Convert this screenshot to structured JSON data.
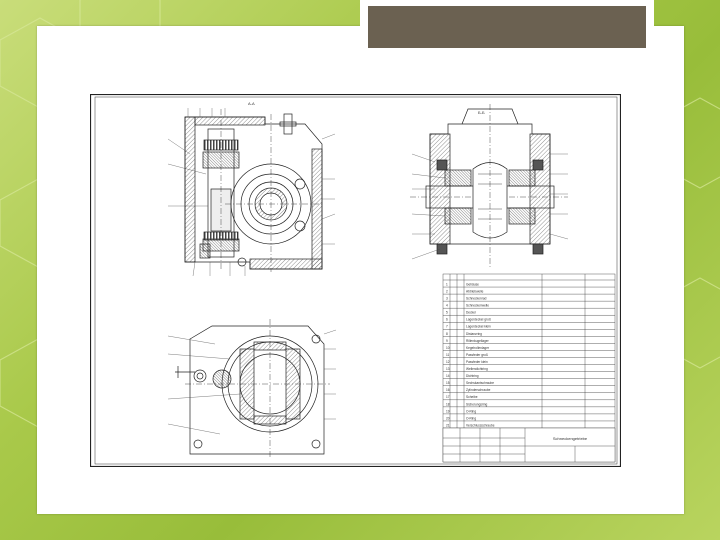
{
  "slide": {
    "title": "",
    "accent_colors": {
      "background": "#a9c94a",
      "title_bar": "#6b6151",
      "paper": "#ffffff"
    }
  },
  "drawing": {
    "view_aa_label": "A-A",
    "view_bb_label": "Б-Б",
    "part_list": {
      "rows": [
        {
          "pos": "1",
          "name": "Gehäuse"
        },
        {
          "pos": "2",
          "name": "Abtriebwelle"
        },
        {
          "pos": "3",
          "name": "Schneckenrad"
        },
        {
          "pos": "4",
          "name": "Schneckenwelle"
        },
        {
          "pos": "5",
          "name": "Deckel"
        },
        {
          "pos": "6",
          "name": "Lagerdeckel groß"
        },
        {
          "pos": "7",
          "name": "Lagerdeckel klein"
        },
        {
          "pos": "8",
          "name": "Distanzring"
        },
        {
          "pos": "9",
          "name": "Rillenkugellager"
        },
        {
          "pos": "10",
          "name": "Kegelrollenlager"
        },
        {
          "pos": "11",
          "name": "Passfeder groß"
        },
        {
          "pos": "12",
          "name": "Passfeder klein"
        },
        {
          "pos": "13",
          "name": "Wellendichtring"
        },
        {
          "pos": "14",
          "name": "Dichtring"
        },
        {
          "pos": "15",
          "name": "Sechskantschraube"
        },
        {
          "pos": "16",
          "name": "Zylinderschraube"
        },
        {
          "pos": "17",
          "name": "Scheibe"
        },
        {
          "pos": "18",
          "name": "Sicherungsring"
        },
        {
          "pos": "19",
          "name": "O-Ring"
        },
        {
          "pos": "20",
          "name": "O-Ring"
        },
        {
          "pos": "21",
          "name": "Verschlussschraube"
        }
      ]
    },
    "title_block_name": "Schneckengetriebe"
  }
}
